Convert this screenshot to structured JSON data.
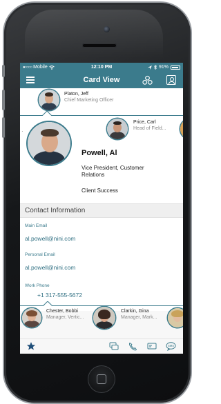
{
  "status_bar": {
    "carrier_dots": "●○○○○",
    "carrier": "Mobile",
    "time": "12:10 PM",
    "battery": "91%"
  },
  "nav": {
    "title": "Card View"
  },
  "manager": {
    "name": "Platon, Jeff",
    "title": "Chief Marketing Officer"
  },
  "peer": {
    "name": "Price, Carl",
    "title": "Head of Field..."
  },
  "selected": {
    "name": "Powell, Al",
    "job_title": "Vice President, Customer Relations",
    "department": "Client Success"
  },
  "contact": {
    "header": "Contact Information",
    "fields": [
      {
        "label": "Main Email",
        "value": "al.powell@nini.com"
      },
      {
        "label": "Personal Email",
        "value": "al.powell@nini.com"
      },
      {
        "label": "Work Phone",
        "value": "+1 317-555-5672"
      }
    ]
  },
  "subordinates": [
    {
      "name": "Chester, Bobbi",
      "title": "Manager, Vertic..."
    },
    {
      "name": "Clarkin, Gina",
      "title": "Manager, Mark..."
    }
  ],
  "icons": {
    "menu": "menu-icon",
    "org": "org-chart-icon",
    "contact": "contact-card-icon",
    "favorite": "star-icon",
    "chat": "chat-icon",
    "phone": "phone-icon",
    "email": "email-icon",
    "sms": "sms-icon"
  },
  "colors": {
    "accent": "#3b7b8c",
    "section_bg": "#efefef"
  }
}
